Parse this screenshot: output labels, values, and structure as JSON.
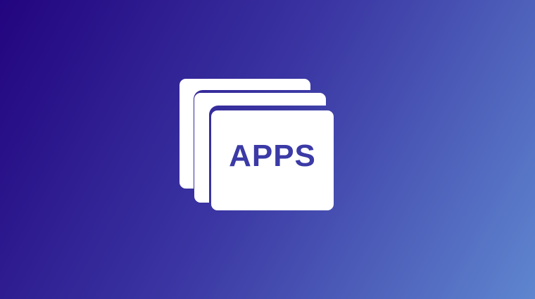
{
  "logo": {
    "text": "APPS",
    "icon": "stacked-windows-icon"
  },
  "colors": {
    "gradient_start": "#22047f",
    "gradient_mid": "#3b36a3",
    "gradient_end": "#5f86cf",
    "card": "#ffffff",
    "text": "#3b3aa6"
  }
}
